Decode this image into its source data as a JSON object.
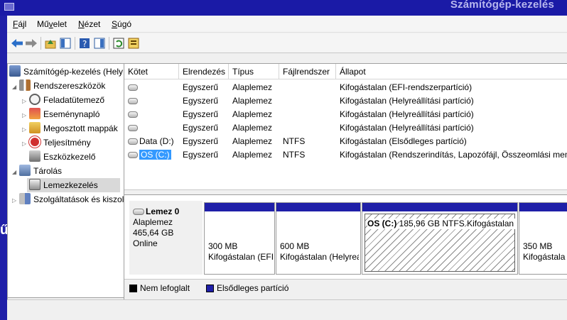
{
  "window": {
    "title": "Számítógép-kezelés"
  },
  "background_fragment": "ű",
  "menu": [
    {
      "label": "Fájl",
      "accel": "F"
    },
    {
      "label": "Művelet",
      "accel": "v"
    },
    {
      "label": "Nézet",
      "accel": "N"
    },
    {
      "label": "Súgó",
      "accel": "S"
    }
  ],
  "toolbar": [
    {
      "icon": "back-arrow-icon"
    },
    {
      "icon": "forward-arrow-icon"
    },
    {
      "icon": "up-folder-icon"
    },
    {
      "icon": "show-hide-tree-icon"
    },
    {
      "icon": "help-icon"
    },
    {
      "icon": "properties-icon"
    },
    {
      "icon": "refresh-icon"
    },
    {
      "icon": "export-list-icon"
    }
  ],
  "tree": {
    "items": [
      {
        "label": "Számítógép-kezelés (Helyi)",
        "level": 0,
        "expander": "",
        "icon": "computer-management-icon"
      },
      {
        "label": "Rendszereszközök",
        "level": 1,
        "expander": "◢",
        "icon": "system-tools-icon"
      },
      {
        "label": "Feladatütemező",
        "level": 2,
        "expander": "▷",
        "icon": "task-scheduler-icon"
      },
      {
        "label": "Eseménynapló",
        "level": 2,
        "expander": "▷",
        "icon": "event-viewer-icon"
      },
      {
        "label": "Megosztott mappák",
        "level": 2,
        "expander": "▷",
        "icon": "shared-folders-icon"
      },
      {
        "label": "Teljesítmény",
        "level": 2,
        "expander": "▷",
        "icon": "performance-icon"
      },
      {
        "label": "Eszközkezelő",
        "level": 2,
        "expander": "",
        "icon": "device-manager-icon"
      },
      {
        "label": "Tárolás",
        "level": 1,
        "expander": "◢",
        "icon": "storage-icon"
      },
      {
        "label": "Lemezkezelés",
        "level": 2,
        "expander": "",
        "icon": "disk-management-icon",
        "selected": true
      },
      {
        "label": "Szolgáltatások és kiszolgálóalkalmazások",
        "level": 1,
        "expander": "▷",
        "icon": "services-icon"
      }
    ]
  },
  "volumes": {
    "columns": [
      "Kötet",
      "Elrendezés",
      "Típus",
      "Fájlrendszer",
      "Állapot"
    ],
    "rows": [
      {
        "volume": "",
        "layout": "Egyszerű",
        "type": "Alaplemez",
        "fs": "",
        "status": "Kifogástalan (EFI-rendszerpartíció)"
      },
      {
        "volume": "",
        "layout": "Egyszerű",
        "type": "Alaplemez",
        "fs": "",
        "status": "Kifogástalan (Helyreállítási partíció)"
      },
      {
        "volume": "",
        "layout": "Egyszerű",
        "type": "Alaplemez",
        "fs": "",
        "status": "Kifogástalan (Helyreállítási partíció)"
      },
      {
        "volume": "",
        "layout": "Egyszerű",
        "type": "Alaplemez",
        "fs": "",
        "status": "Kifogástalan (Helyreállítási partíció)"
      },
      {
        "volume": "Data (D:)",
        "layout": "Egyszerű",
        "type": "Alaplemez",
        "fs": "NTFS",
        "status": "Kifogástalan (Elsődleges partíció)"
      },
      {
        "volume": "OS (C:)",
        "layout": "Egyszerű",
        "type": "Alaplemez",
        "fs": "NTFS",
        "status": "Kifogástalan (Rendszerindítás, Lapozófájl, Összeomlási memóriakép, Elsődleges partíció)",
        "selected": true
      }
    ]
  },
  "disk": {
    "name": "Lemez 0",
    "kind": "Alaplemez",
    "size": "465,64 GB",
    "state": "Online",
    "partitions": [
      {
        "name": "",
        "size": "300 MB",
        "status": "Kifogástalan (EFI-rendszerpartíció)"
      },
      {
        "name": "",
        "size": "600 MB",
        "status": "Kifogástalan (Helyreállítási partíció)"
      },
      {
        "name": "OS  (C:)",
        "size": "185,96 GB NTFS",
        "status": "Kifogástalan (Rendszerindítás, Lapozófájl, Összeomlási memóriakép)",
        "selected": true
      },
      {
        "name": "",
        "size": "350 MB",
        "status": "Kifogástalan (Helyreállítási partíció)"
      }
    ]
  },
  "legend": [
    {
      "label": "Nem lefoglalt",
      "color": "#000000"
    },
    {
      "label": "Elsődleges partíció",
      "color": "#1f1fa8"
    }
  ],
  "colors": {
    "primary_partition": "#1f1fa8",
    "selection": "#3399ff"
  }
}
